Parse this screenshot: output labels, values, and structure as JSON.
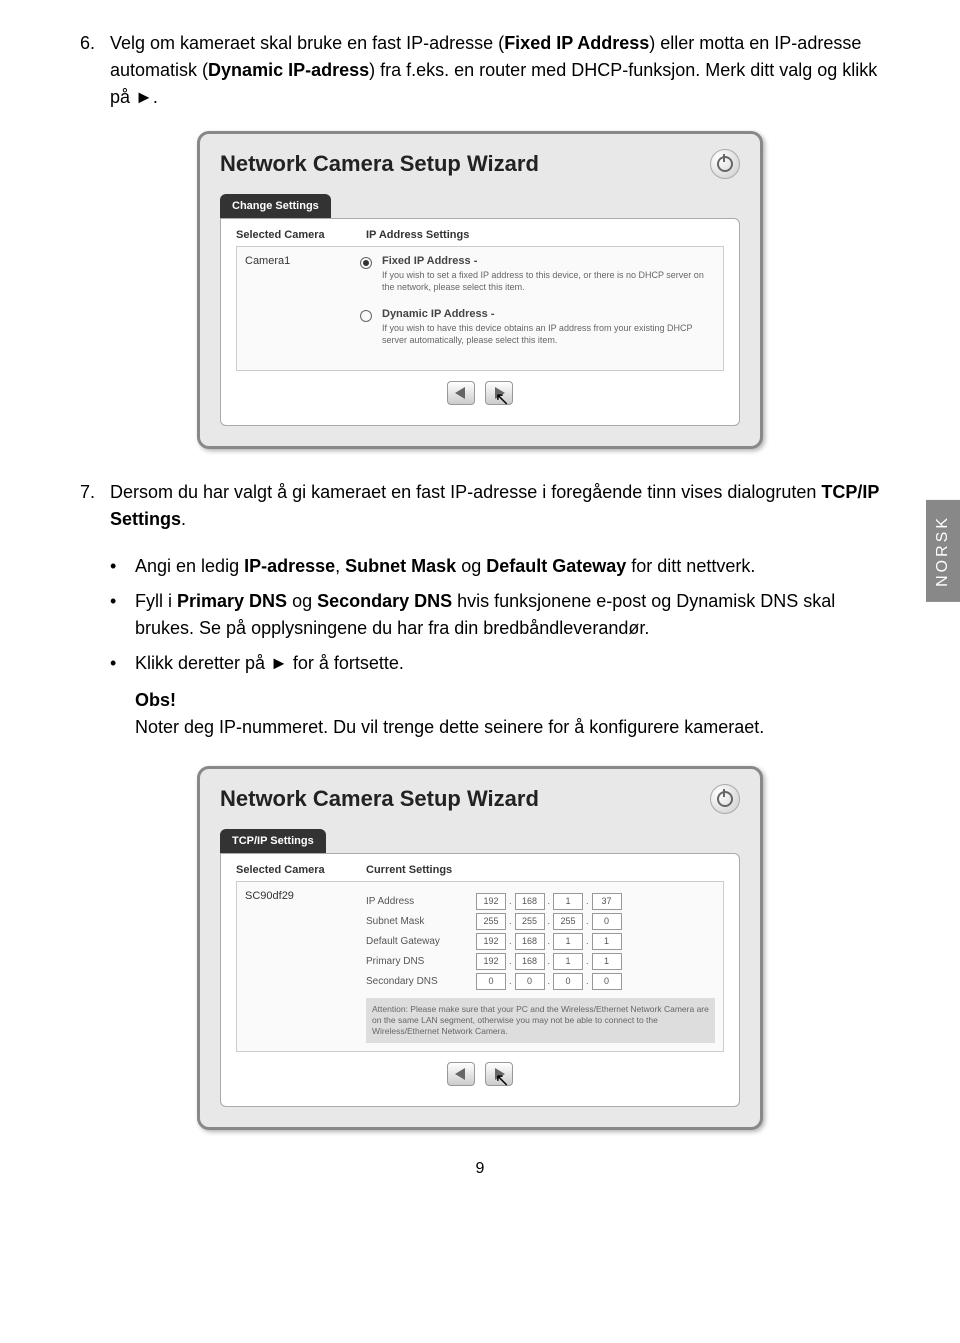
{
  "step6": {
    "num": "6.",
    "text_before": "Velg om kameraet skal bruke en fast IP-adresse (",
    "b1": "Fixed IP Address",
    "text_mid1": ") eller motta en IP-adresse automatisk (",
    "b2": "Dynamic IP-adress",
    "text_mid2": ") fra f.eks. en router med DHCP-funksjon. Merk ditt valg og klikk på ►."
  },
  "wizard1": {
    "title": "Network Camera Setup Wizard",
    "tab": "Change Settings",
    "col1": "Selected Camera",
    "col2": "IP Address Settings",
    "cam": "Camera1",
    "opt1_title": "Fixed IP Address -",
    "opt1_desc": "If you wish to set a fixed IP address to this device, or there is no DHCP server on the network, please select this item.",
    "opt2_title": "Dynamic IP Address -",
    "opt2_desc": "If you wish to have this device obtains an IP address from your existing DHCP server automatically, please select this item."
  },
  "side_tab": "NORSK",
  "step7": {
    "num": "7.",
    "text_before": "Dersom du har valgt å gi kameraet en fast IP-adresse i foregående tinn vises dialogruten ",
    "b1": "TCP/IP Settings",
    "text_after": "."
  },
  "bullets": {
    "b1_pre": "Angi en ledig ",
    "b1_b1": "IP-adresse",
    "b1_mid1": ", ",
    "b1_b2": "Subnet Mask",
    "b1_mid2": " og ",
    "b1_b3": "Default Gateway",
    "b1_post": " for ditt nettverk.",
    "b2_pre": "Fyll i ",
    "b2_b1": "Primary DNS",
    "b2_mid": " og ",
    "b2_b2": "Secondary DNS",
    "b2_post": " hvis funksjonene e-post og Dynamisk DNS skal brukes. Se på opplysningene du har fra din bredbåndleverandør.",
    "b3": "Klikk deretter på ► for å fortsette.",
    "obs": "Obs!",
    "obs_text": "Noter deg IP-nummeret. Du vil trenge dette seinere for å konfigurere kameraet."
  },
  "wizard2": {
    "title": "Network Camera Setup Wizard",
    "tab": "TCP/IP Settings",
    "col1": "Selected Camera",
    "col2": "Current Settings",
    "cam": "SC90df29",
    "rows": {
      "ip": {
        "label": "IP Address",
        "v": [
          "192",
          "168",
          "1",
          "37"
        ]
      },
      "sm": {
        "label": "Subnet Mask",
        "v": [
          "255",
          "255",
          "255",
          "0"
        ]
      },
      "gw": {
        "label": "Default Gateway",
        "v": [
          "192",
          "168",
          "1",
          "1"
        ]
      },
      "pd": {
        "label": "Primary DNS",
        "v": [
          "192",
          "168",
          "1",
          "1"
        ]
      },
      "sd": {
        "label": "Secondary DNS",
        "v": [
          "0",
          "0",
          "0",
          "0"
        ]
      }
    },
    "attention": "Attention: Please make sure that your PC and the Wireless/Ethernet Network Camera are on the same LAN segment, otherwise you may not be able to connect to the Wireless/Ethernet Network Camera."
  },
  "page_num": "9"
}
